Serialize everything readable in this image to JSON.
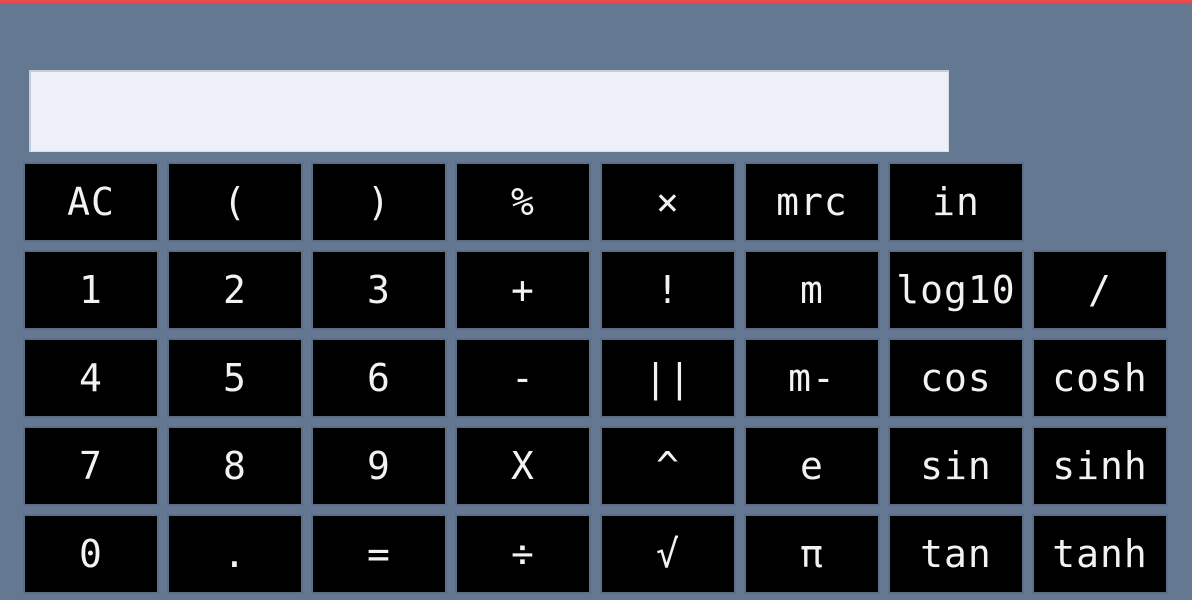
{
  "display": {
    "value": ""
  },
  "buttons": {
    "ac": "AC",
    "open_paren": "(",
    "close_paren": ")",
    "percent": "%",
    "close": "×",
    "mrc": "mrc",
    "ln": "in",
    "one": "1",
    "two": "2",
    "three": "3",
    "plus": "+",
    "factorial": "!",
    "m": "m",
    "log10": "log10",
    "slash": "/",
    "four": "4",
    "five": "5",
    "six": "6",
    "minus": "-",
    "abs": "||",
    "m_minus": "m-",
    "cos": "cos",
    "cosh": "cosh",
    "seven": "7",
    "eight": "8",
    "nine": "9",
    "multiply": "X",
    "power": "^",
    "e": "e",
    "sin": "sin",
    "sinh": "sinh",
    "zero": "0",
    "dot": ".",
    "equals": "=",
    "divide": "÷",
    "sqrt": "√",
    "pi": "π",
    "tan": "tan",
    "tanh": "tanh"
  }
}
